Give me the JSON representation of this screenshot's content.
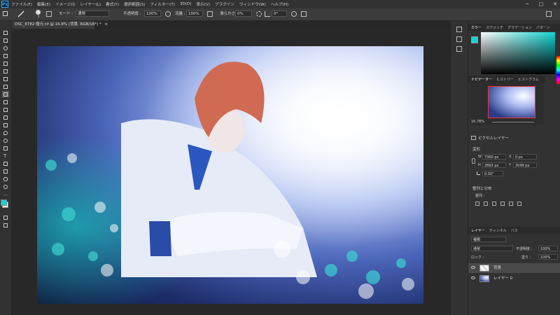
{
  "menu": [
    "ファイル(F)",
    "編集(E)",
    "イメージ(I)",
    "レイヤー(L)",
    "書式(Y)",
    "選択範囲(S)",
    "フィルター(T)",
    "3D(D)",
    "表示(V)",
    "プラグイン",
    "ウィンドウ(W)",
    "ヘルプ(H)"
  ],
  "app_icon": "Ps",
  "window_controls": [
    "─",
    "□",
    "✕"
  ],
  "options": {
    "brush_size": "5",
    "mode_label": "モード :",
    "mode_value": "通常",
    "opacity_label": "不透明度 :",
    "opacity_value": "100%",
    "flow_label": "流量 :",
    "flow_value": "100%",
    "smoothing_label": "滑らかさ :",
    "smoothing_value": "0%",
    "angle_value": "0°"
  },
  "document": {
    "tab_title": "DSC_8782-復元.tif @ 16.8% (背景, RGB/16*) *",
    "tab_close": "×"
  },
  "color_panel": {
    "tabs": [
      "カラー",
      "スウォッチ",
      "グラデーション",
      "パターン"
    ],
    "accent_hex": "#12d4d4"
  },
  "navigator": {
    "tabs": [
      "ナビゲーター",
      "ヒストリー",
      "ヒストグラム"
    ],
    "zoom": "16.78%"
  },
  "properties": {
    "pixel_layer": "ピクセルレイヤー",
    "transform_label": "変形",
    "w_label": "W",
    "w_value": "7360 px",
    "h_label": "H",
    "h_value": "2863 px",
    "x_label": "X",
    "x_value": "0 px",
    "y_label": "Y",
    "y_value": "2049 px",
    "angle_value": "0.00°",
    "align_label": "整列と分布",
    "align_sub": "整列 :"
  },
  "layers_panel": {
    "tabs": [
      "レイヤー",
      "チャンネル",
      "パス"
    ],
    "kind_filter": "種類",
    "blend_mode": "通常",
    "opacity_label": "不透明度 :",
    "opacity_value": "100%",
    "lock_label": "ロック :",
    "fill_label": "塗り :",
    "fill_value": "100%",
    "layers": [
      {
        "name": "背景"
      },
      {
        "name": "レイヤー 0"
      }
    ]
  }
}
